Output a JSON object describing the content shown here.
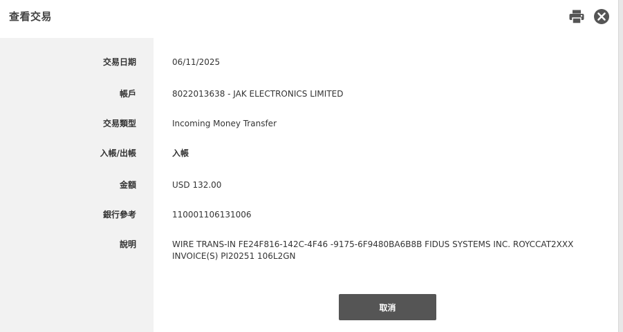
{
  "dialog": {
    "title": "查看交易",
    "print_icon": "print-icon",
    "close_icon": "close-icon"
  },
  "details": [
    {
      "label": "交易日期",
      "value": "06/11/2025"
    },
    {
      "label": "帳戶",
      "value": "8022013638 - JAK ELECTRONICS LIMITED"
    },
    {
      "label": "交易類型",
      "value": "Incoming Money Transfer"
    },
    {
      "label": "入帳/出帳",
      "value": "入帳"
    },
    {
      "label": "金額",
      "value": "USD 132.00"
    },
    {
      "label": "銀行參考",
      "value": "110001106131006"
    },
    {
      "label": "說明",
      "value": "WIRE TRANS-IN FE24F816-142C-4F46 -9175-6F9480BA6B8B FIDUS SYSTEMS INC. ROYCCAT2XXX INVOICE(S) PI20251 106L2GN"
    }
  ],
  "actions": {
    "cancel_label": "取消"
  },
  "colors": {
    "label_bg": "#f2f2f2",
    "button_bg": "#555555",
    "icon": "#555555"
  }
}
